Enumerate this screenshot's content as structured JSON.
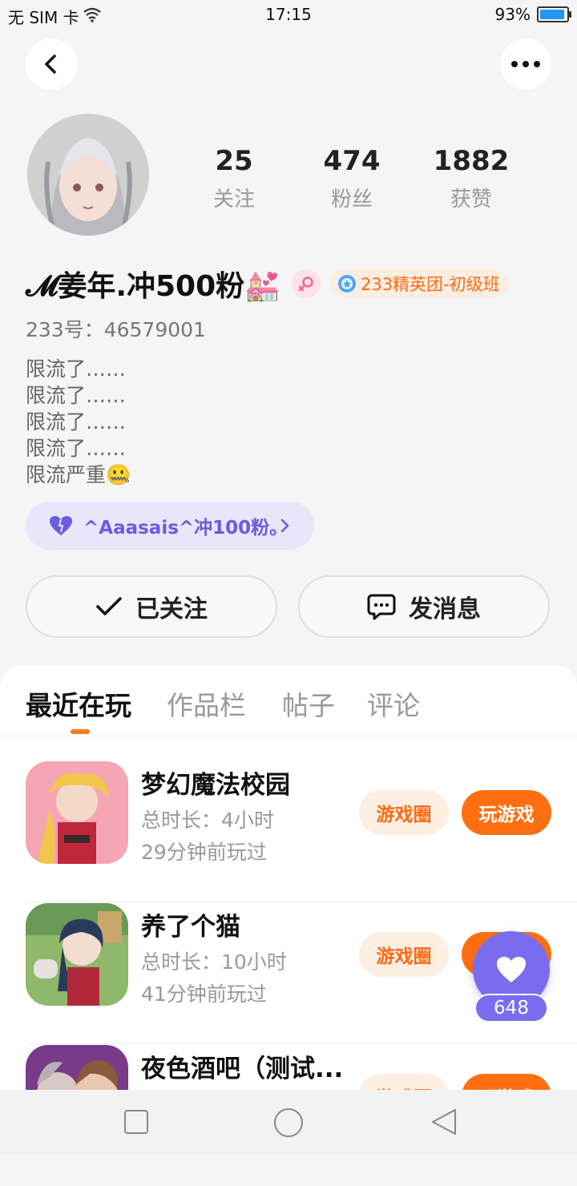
{
  "status_bar": {
    "carrier": "无 SIM 卡",
    "time": "17:15",
    "battery": "93%",
    "battery_level": 0.93
  },
  "profile": {
    "stats": [
      {
        "value": "25",
        "label": "关注"
      },
      {
        "value": "474",
        "label": "粉丝"
      },
      {
        "value": "1882",
        "label": "获赞"
      }
    ],
    "nickname": "𝓜姜年.冲500粉💒",
    "badge": "233精英团-初级班",
    "uid": "233号：46579001",
    "bio": [
      "限流了……",
      "限流了……",
      "限流了……",
      "限流了……",
      "限流严重🤐"
    ],
    "fan_group": "^Aaasais^冲100粉。"
  },
  "actions": {
    "follow": "已关注",
    "message": "发消息"
  },
  "tabs": [
    "最近在玩",
    "作品栏",
    "帖子",
    "评论"
  ],
  "games": [
    {
      "title": "梦幻魔法校园",
      "duration": "总时长：4小时",
      "last_played": "29分钟前玩过",
      "circle": "游戏圈",
      "play": "玩游戏"
    },
    {
      "title": "养了个猫",
      "duration": "总时长：10小时",
      "last_played": "41分钟前玩过",
      "circle": "游戏圈",
      "play": "玩游戏"
    },
    {
      "title": "夜色酒吧（测试...",
      "duration": "",
      "last_played": "",
      "circle": "游戏圈",
      "play": "玩游戏"
    }
  ],
  "like": {
    "count": "648"
  },
  "colors": {
    "accent": "#ff6f0f",
    "purple": "#7a6cf0",
    "badge_text": "#ff6a13"
  }
}
